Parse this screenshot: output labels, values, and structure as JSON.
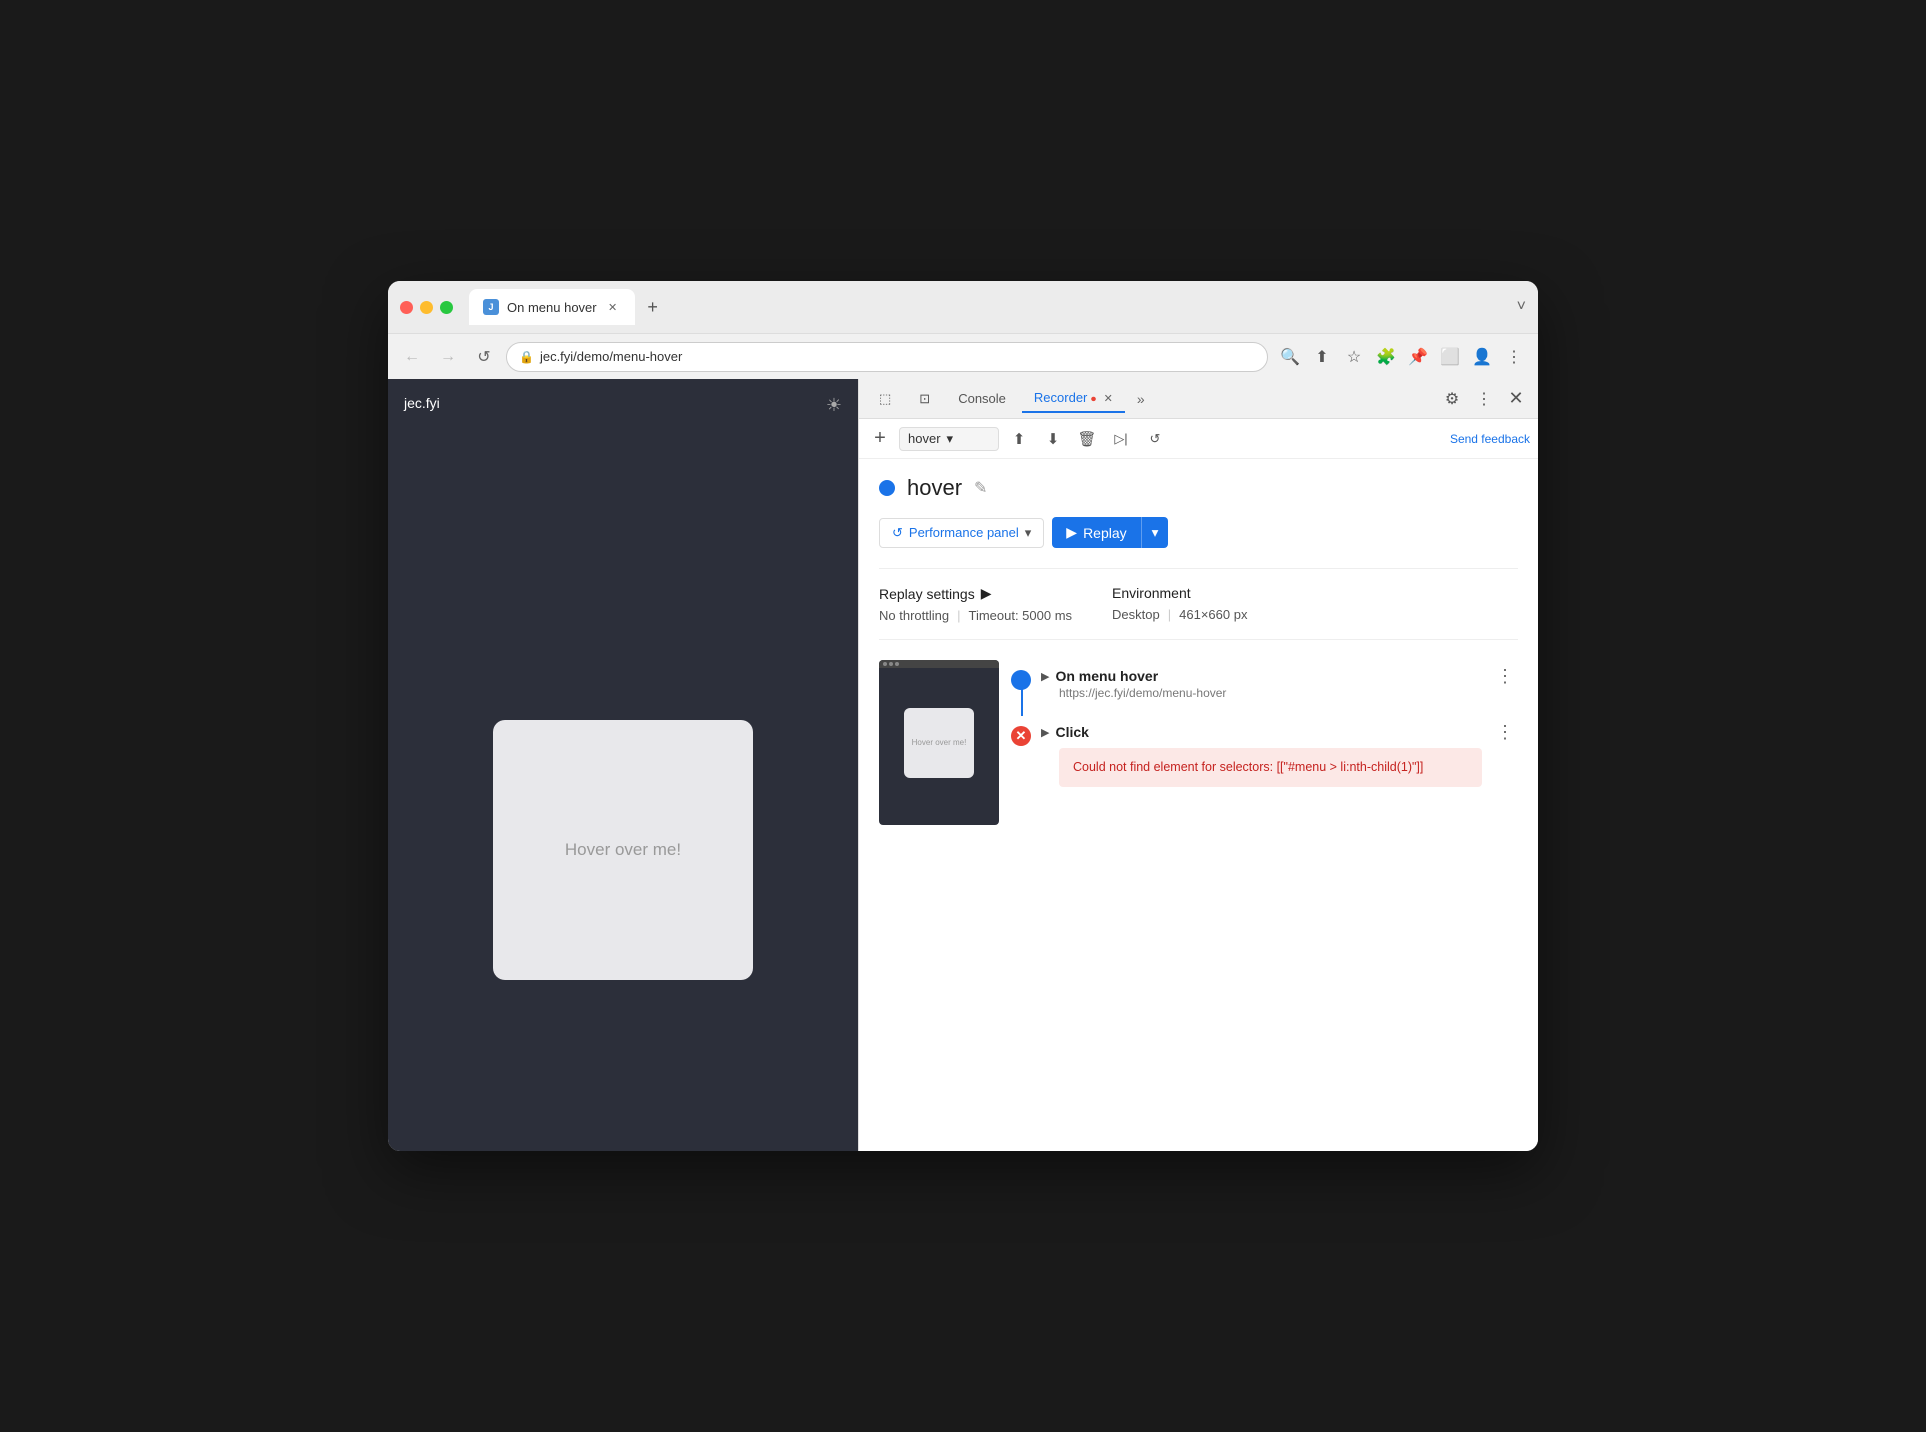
{
  "browser": {
    "tab_title": "On menu hover",
    "tab_favicon_text": "J",
    "address": "jec.fyi/demo/menu-hover",
    "new_tab_label": "+",
    "expand_label": "˅"
  },
  "nav": {
    "back_icon": "←",
    "forward_icon": "→",
    "refresh_icon": "↺"
  },
  "toolbar_icons": [
    "🔍",
    "⬆",
    "★",
    "🧩",
    "🖊",
    "⬜",
    "👤",
    "⋮"
  ],
  "webpage": {
    "logo": "jec.fyi",
    "hover_text": "Hover over me!"
  },
  "devtools": {
    "tabs": [
      "Console",
      "Recorder"
    ],
    "active_tab": "Recorder",
    "recorder_badge": "🔴",
    "more_icon": "»",
    "settings_icon": "⚙",
    "dots_icon": "⋮",
    "close_icon": "✕"
  },
  "recorder_toolbar": {
    "plus_label": "+",
    "dropdown_value": "hover",
    "dropdown_arrow": "▾",
    "upload_icon": "⬆",
    "download_icon": "⬇",
    "delete_icon": "🗑",
    "play_icon": "▶",
    "replay_all_icon": "↺",
    "send_feedback": "Send feedback"
  },
  "recording": {
    "title": "hover",
    "edit_icon": "✎",
    "dot_color": "#1a73e8"
  },
  "perf_panel": {
    "icon": "↺",
    "label": "Performance panel",
    "arrow": "▾"
  },
  "replay_btn": {
    "icon": "▶",
    "label": "Replay",
    "dropdown_arrow": "▾"
  },
  "settings": {
    "replay_settings_label": "Replay settings",
    "replay_settings_arrow": "▶",
    "throttling": "No throttling",
    "timeout": "Timeout: 5000 ms",
    "environment_label": "Environment",
    "desktop": "Desktop",
    "resolution": "461×660 px"
  },
  "steps": [
    {
      "type": "navigate",
      "title": "On menu hover",
      "subtitle": "https://jec.fyi/demo/menu-hover",
      "indicator": "blue",
      "has_connector": true
    },
    {
      "type": "click",
      "title": "Click",
      "subtitle": "",
      "indicator": "red",
      "has_connector": false,
      "error": "Could not find element for selectors: [[\"#menu > li:nth-child(1)\"]]"
    }
  ]
}
